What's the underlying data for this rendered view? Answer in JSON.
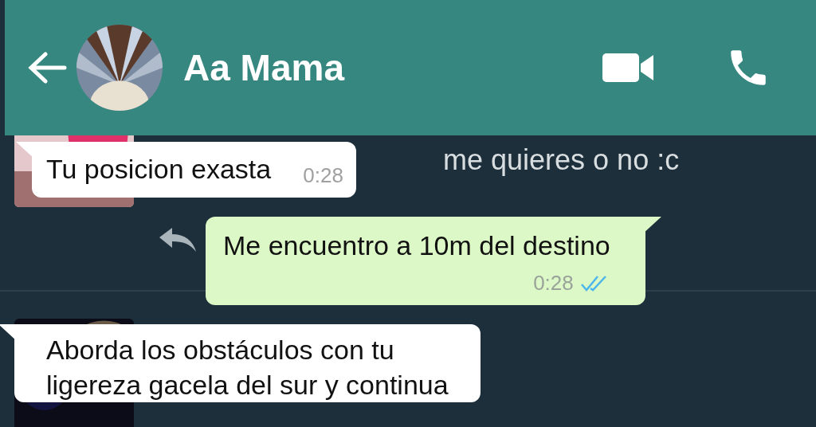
{
  "header": {
    "contact_name": "Aa Mama"
  },
  "wallpaper": {
    "text": "me quieres o no :c"
  },
  "messages": [
    {
      "kind": "incoming",
      "lines": [
        "Tu posicion exasta"
      ],
      "time": "0:28"
    },
    {
      "kind": "outgoing",
      "lines": [
        "Me encuentro a 10m del destino"
      ],
      "time": "0:28",
      "read": true
    },
    {
      "kind": "incoming",
      "lines": [
        "Aborda los obstáculos con tu",
        "ligereza gacela del sur y continua"
      ]
    }
  ]
}
